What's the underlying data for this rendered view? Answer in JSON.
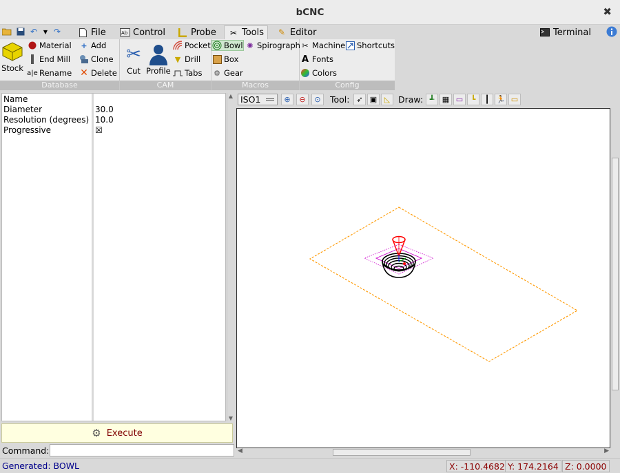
{
  "window": {
    "title": "bCNC",
    "close_glyph": "✖"
  },
  "tabs": [
    {
      "label": "File",
      "icon": "file-icon"
    },
    {
      "label": "Control",
      "icon": "control-icon"
    },
    {
      "label": "Probe",
      "icon": "probe-icon"
    },
    {
      "label": "Tools",
      "icon": "tools-icon",
      "active": true
    },
    {
      "label": "Editor",
      "icon": "editor-icon"
    }
  ],
  "terminal_tab": {
    "label": "Terminal"
  },
  "ribbon": {
    "database": {
      "label": "Database",
      "stock": "Stock",
      "material": "Material",
      "end_mill": "End Mill",
      "rename": "Rename",
      "add": "Add",
      "clone": "Clone",
      "delete": "Delete"
    },
    "cam": {
      "label": "CAM",
      "cut": "Cut",
      "profile": "Profile",
      "pocket": "Pocket",
      "drill": "Drill",
      "tabs": "Tabs"
    },
    "macros": {
      "label": "Macros",
      "bowl": "Bowl",
      "spirograph": "Spirograph",
      "box": "Box",
      "gear": "Gear"
    },
    "config": {
      "label": "Config",
      "machine": "Machine",
      "shortcuts": "Shortcuts",
      "fonts": "Fonts",
      "colors": "Colors"
    }
  },
  "properties": [
    {
      "name": "Name",
      "value": ""
    },
    {
      "name": "Diameter",
      "value": "30.0"
    },
    {
      "name": "Resolution (degrees)",
      "value": "10.0"
    },
    {
      "name": "Progressive",
      "value": "☒"
    }
  ],
  "execute": {
    "label": "Execute"
  },
  "command": {
    "label": "Command:",
    "value": ""
  },
  "canvas_toolbar": {
    "view": "ISO1",
    "tool_label": "Tool:",
    "draw_label": "Draw:"
  },
  "status": {
    "message": "Generated: BOWL",
    "x": "X: -110.4682",
    "y": "Y: 174.2164",
    "z": "Z: 0.0000"
  },
  "colors": {
    "margin_outline": "#ff9900",
    "toolpath": "#000000",
    "gantry": "#ff0000",
    "bounding": "#cc00cc"
  }
}
